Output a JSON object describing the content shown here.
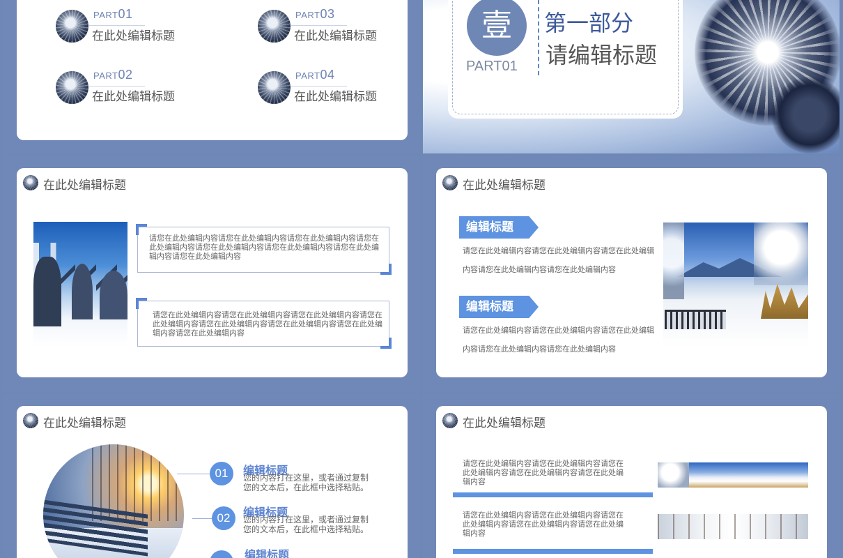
{
  "slide1": {
    "items": [
      {
        "part": "PART",
        "num": "01",
        "title": "在此处编辑标题"
      },
      {
        "part": "PART",
        "num": "02",
        "title": "在此处编辑标题"
      },
      {
        "part": "PART",
        "num": "03",
        "title": "在此处编辑标题"
      },
      {
        "part": "PART",
        "num": "04",
        "title": "在此处编辑标题"
      }
    ]
  },
  "slide2": {
    "char": "壹",
    "part": "PART01",
    "title_line1": "第一部分",
    "title_line2": "请编辑标题"
  },
  "slide3": {
    "header": "在此处编辑标题",
    "box1_text": "请您在此处编辑内容请您在此处编辑内容请您在此处编辑内容请您在此处编辑内容请您在此处编辑内容请您在此处编辑内容请您在此处编辑内容请您在此处编辑内容",
    "box2_text": "请您在此处编辑内容请您在此处编辑内容请您在此处编辑内容请您在此处编辑内容请您在此处编辑内容请您在此处编辑内容请您在此处编辑内容请您在此处编辑内容"
  },
  "slide4": {
    "header": "在此处编辑标题",
    "sections": [
      {
        "label": "编辑标题",
        "line1": "请您在此处编辑内容请您在此处编辑内容请您在此处编辑",
        "line2": "内容请您在此处编辑内容请您在此处编辑内容"
      },
      {
        "label": "编辑标题",
        "line1": "请您在此处编辑内容请您在此处编辑内容请您在此处编辑",
        "line2": "内容请您在此处编辑内容请您在此处编辑内容"
      }
    ]
  },
  "slide5": {
    "header": "在此处编辑标题",
    "items": [
      {
        "num": "01",
        "title": "编辑标题",
        "line1": "您的内容打在这里，或者通过复制",
        "line2": "您的文本后，在此框中选择粘贴。"
      },
      {
        "num": "02",
        "title": "编辑标题",
        "line1": "您的内容打在这里，或者通过复制",
        "line2": "您的文本后，在此框中选择粘贴。"
      },
      {
        "num": "",
        "title": "编辑标题"
      }
    ]
  },
  "slide6": {
    "header": "在此处编辑标题",
    "rows": [
      {
        "line1": "请您在此处编辑内容请您在此处编辑内容请您在",
        "line2": "此处编辑内容请您在此处编辑内容请您在此处编",
        "line3": "辑内容"
      },
      {
        "line1": "请您在此处编辑内容请您在此处编辑内容请您在",
        "line2": "此处编辑内容请您在此处编辑内容请您在此处编",
        "line3": "辑内容"
      }
    ]
  },
  "colors": {
    "accent": "#5d93e0",
    "frame_bg": "#7088b8",
    "title": "#6e84b4"
  }
}
